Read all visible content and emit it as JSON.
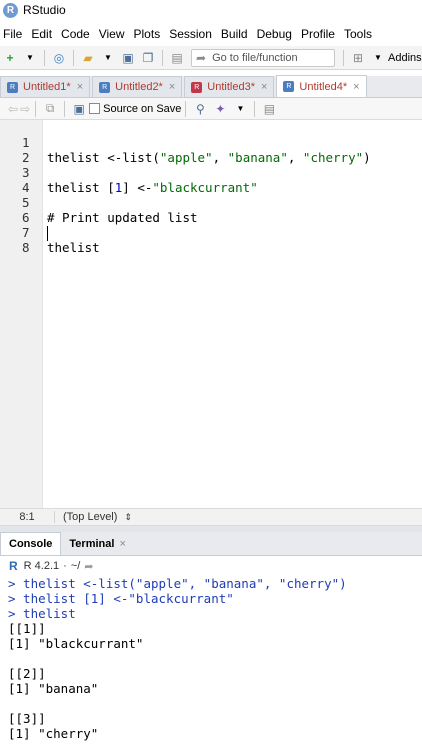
{
  "window": {
    "title": "RStudio"
  },
  "menu": [
    "File",
    "Edit",
    "Code",
    "View",
    "Plots",
    "Session",
    "Build",
    "Debug",
    "Profile",
    "Tools"
  ],
  "toolbar": {
    "goto_placeholder": "Go to file/function",
    "addins_label": "Addins"
  },
  "tabs": [
    {
      "label": "Untitled1*",
      "icon": "r-file-icon",
      "active": false
    },
    {
      "label": "Untitled2*",
      "icon": "r-file-icon",
      "active": false
    },
    {
      "label": "Untitled3*",
      "icon": "rmd-file-icon",
      "active": false
    },
    {
      "label": "Untitled4*",
      "icon": "r-file-icon",
      "active": true
    }
  ],
  "editor_toolbar": {
    "source_on_save_label": "Source on Save"
  },
  "editor": {
    "lines": [
      {
        "num": "1",
        "text": "thelist <-list(\"apple\", \"banana\", \"cherry\")"
      },
      {
        "num": "2",
        "text": ""
      },
      {
        "num": "3",
        "text": "thelist [1] <-\"blackcurrant\""
      },
      {
        "num": "4",
        "text": ""
      },
      {
        "num": "5",
        "text": "# Print updated list"
      },
      {
        "num": "6",
        "text": ""
      },
      {
        "num": "7",
        "text": "thelist"
      },
      {
        "num": "8",
        "text": ""
      }
    ]
  },
  "status": {
    "cursor": "8:1",
    "scope": "(Top Level)"
  },
  "console_tabs": [
    "Console",
    "Terminal"
  ],
  "console_header": {
    "r_version": "R 4.2.1",
    "wd": "~/"
  },
  "console": {
    "lines": [
      {
        "kind": "input",
        "text": "> thelist <-list(\"apple\", \"banana\", \"cherry\")"
      },
      {
        "kind": "input",
        "text": "> thelist [1] <-\"blackcurrant\""
      },
      {
        "kind": "input",
        "text": "> thelist"
      },
      {
        "kind": "output",
        "text": "[[1]]"
      },
      {
        "kind": "output",
        "text": "[1] \"blackcurrant\""
      },
      {
        "kind": "output",
        "text": ""
      },
      {
        "kind": "output",
        "text": "[[2]]"
      },
      {
        "kind": "output",
        "text": "[1] \"banana\""
      },
      {
        "kind": "output",
        "text": ""
      },
      {
        "kind": "output",
        "text": "[[3]]"
      },
      {
        "kind": "output",
        "text": "[1] \"cherry\""
      }
    ]
  },
  "colors": {
    "console_input": "#1e3db8",
    "string": "#036a07",
    "number": "#0000cd",
    "comment": "#4c886b",
    "unsaved_tab_text": "#b03a2e"
  }
}
